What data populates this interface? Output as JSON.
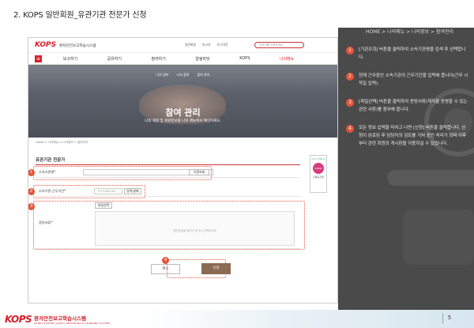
{
  "slide": {
    "title": "2. KOPS 일반회원_유관기관 전문가 신청",
    "breadcrumb": "HOME > 나의메뉴 > 나의정보 > 참여관리",
    "page_number": "5",
    "footer_logo": "KOPS",
    "footer_title": "환자안전보고학습시스템",
    "footer_sub": "KOREA PATIENT SAFETY REPORTING & LEARNING SYSTEM"
  },
  "steps": [
    {
      "num": "1",
      "text": "[기관조회] 버튼을 클릭하여 소속기관명을 검색 후 선택합니다."
    },
    {
      "num": "2",
      "text": "현재 근무중인 소속기관의 근무기간을 입력해 줍니다(근무 시작일 입력)."
    },
    {
      "num": "3",
      "text": "[파일선택] 버튼을 클릭하여 증빙서류(재직을 증명할 수 있는 관련 서류)를 첨부해 줍니다."
    },
    {
      "num": "4",
      "text": "모든 정보 입력을 마치고 나면 [신청] 버튼을 클릭합니다. 신청이 완료된 후 담당자의 검토를 거쳐 승인 처리가 되며 이후부터 관련 회원의 게시판을 이용하실 수 있습니다."
    }
  ],
  "site": {
    "logo": "KOPS",
    "logo_sub": "환자안전보고학습시스템",
    "top_links": [
      "일반회원",
      "보고자",
      "로그아웃"
    ],
    "search_placeholder": "검색어를 입력하세요",
    "menu_icon": "hamburger-icon",
    "nav": [
      "보고하기",
      "공유하기",
      "참여하기",
      "알림마당",
      "KOPS",
      "나의메뉴"
    ],
    "sub_tabs": [
      "나의 정보",
      "나의 참여",
      "참여 관리"
    ],
    "hero_title": "참여 관리",
    "hero_desc": "나의 계정 및 회원정보를 나의 메뉴에서 확인하세요.",
    "crumbs": "Home > 나의메뉴 > 나의정보 > 참여관리",
    "quick_menu": "Quick Menu",
    "quick_circle": "Safety",
    "quick_label": "소통공간방",
    "form_title": "유관기관 전문가",
    "org_label": "소속기관명*",
    "org_button": "기관조회",
    "period_label": "소속기관 근무기간*",
    "period_placeholder": "YYYY.MM.DD",
    "period_button": "달력/날짜",
    "file_label": "증빙서류*",
    "file_button": "파일선택",
    "upload_hint": "첨부파일을 끌어다 놓거나 선택하세요",
    "cancel": "취소",
    "submit": "신청"
  },
  "badges": [
    "1",
    "2",
    "3",
    "4"
  ]
}
